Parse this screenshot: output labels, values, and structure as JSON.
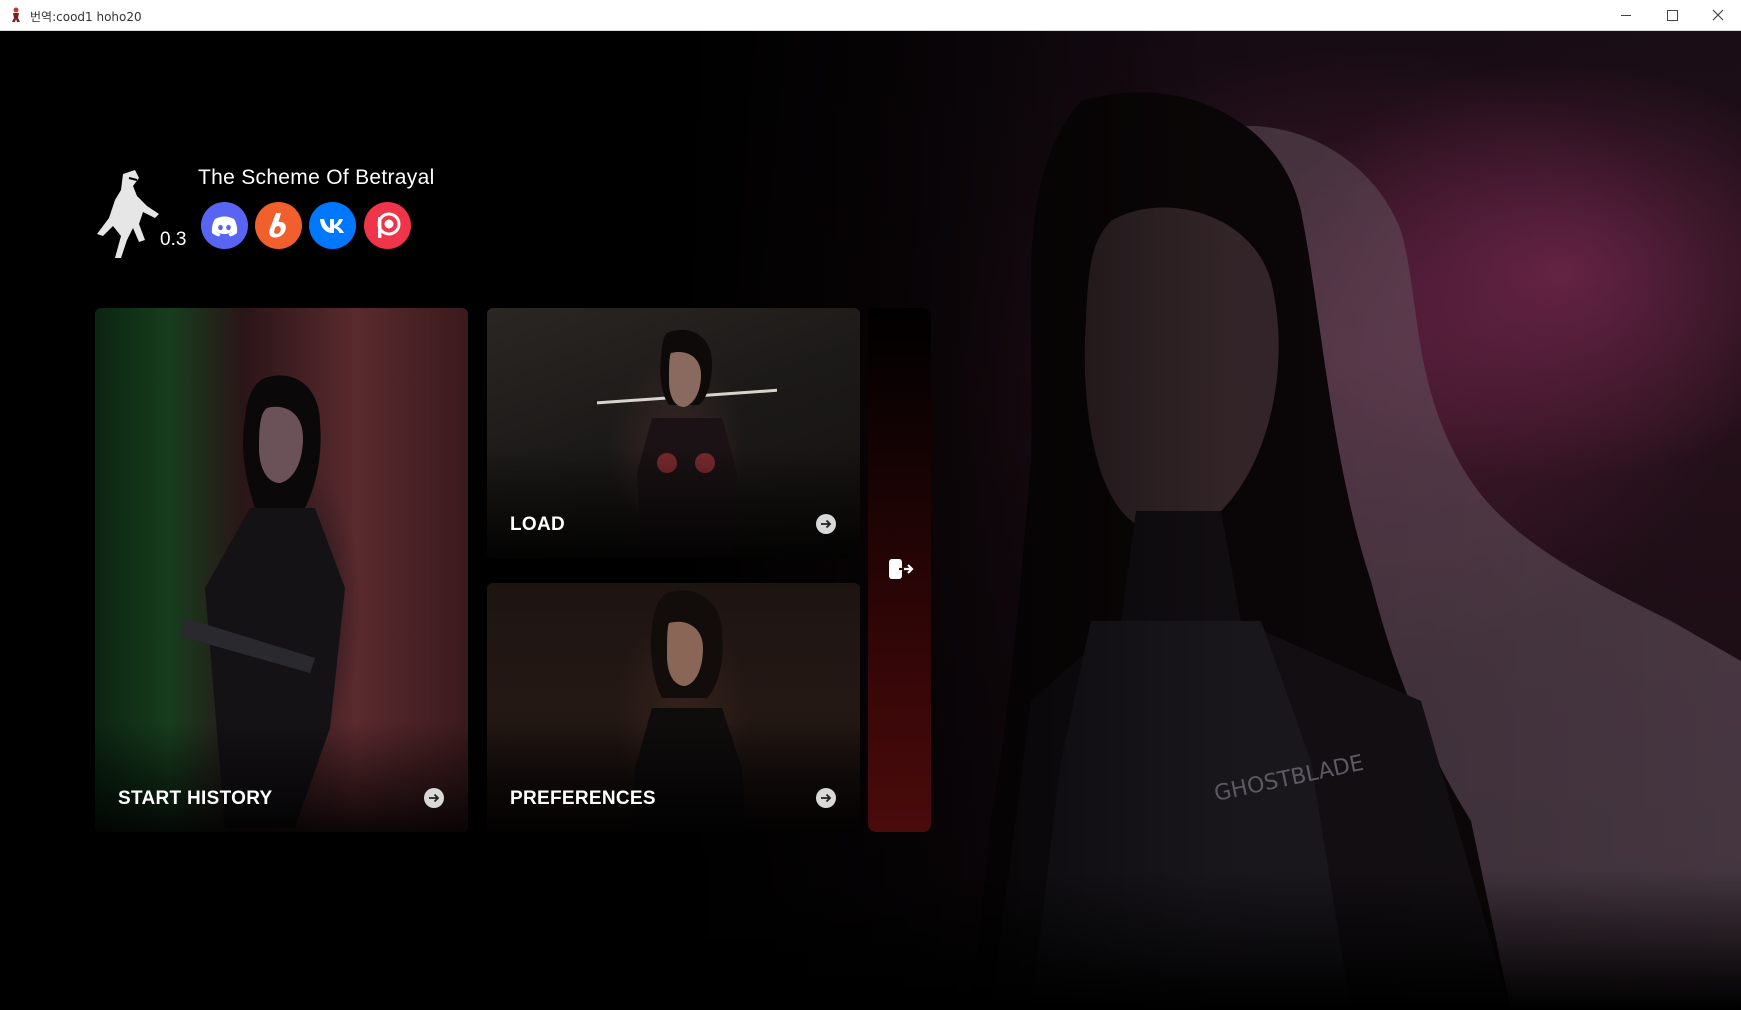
{
  "window": {
    "title": "번역:cood1 hoho20",
    "controls": {
      "minimize": "minimize",
      "maximize": "maximize",
      "close": "close"
    }
  },
  "game": {
    "title": "The Scheme Of Betrayal",
    "version": "0.3",
    "logo_icon": "ninja-logo-icon"
  },
  "social": [
    {
      "name": "discord",
      "icon": "discord-icon",
      "color": "#5865f2"
    },
    {
      "name": "boosty",
      "icon": "boosty-icon",
      "color": "#f15f2c"
    },
    {
      "name": "vk",
      "icon": "vk-icon",
      "color": "#0077ff"
    },
    {
      "name": "patreon",
      "icon": "patreon-icon",
      "color": "#f0344a"
    }
  ],
  "menu": {
    "start": {
      "label": "START HISTORY",
      "icon": "arrow-right-icon"
    },
    "load": {
      "label": "LOAD",
      "icon": "arrow-right-icon"
    },
    "preferences": {
      "label": "PREFERENCES",
      "icon": "arrow-right-icon"
    },
    "exit": {
      "icon": "exit-icon"
    }
  },
  "colors": {
    "accent": "#e53b3b",
    "exit_panel": "#4a0b0c",
    "text": "#ffffff"
  }
}
